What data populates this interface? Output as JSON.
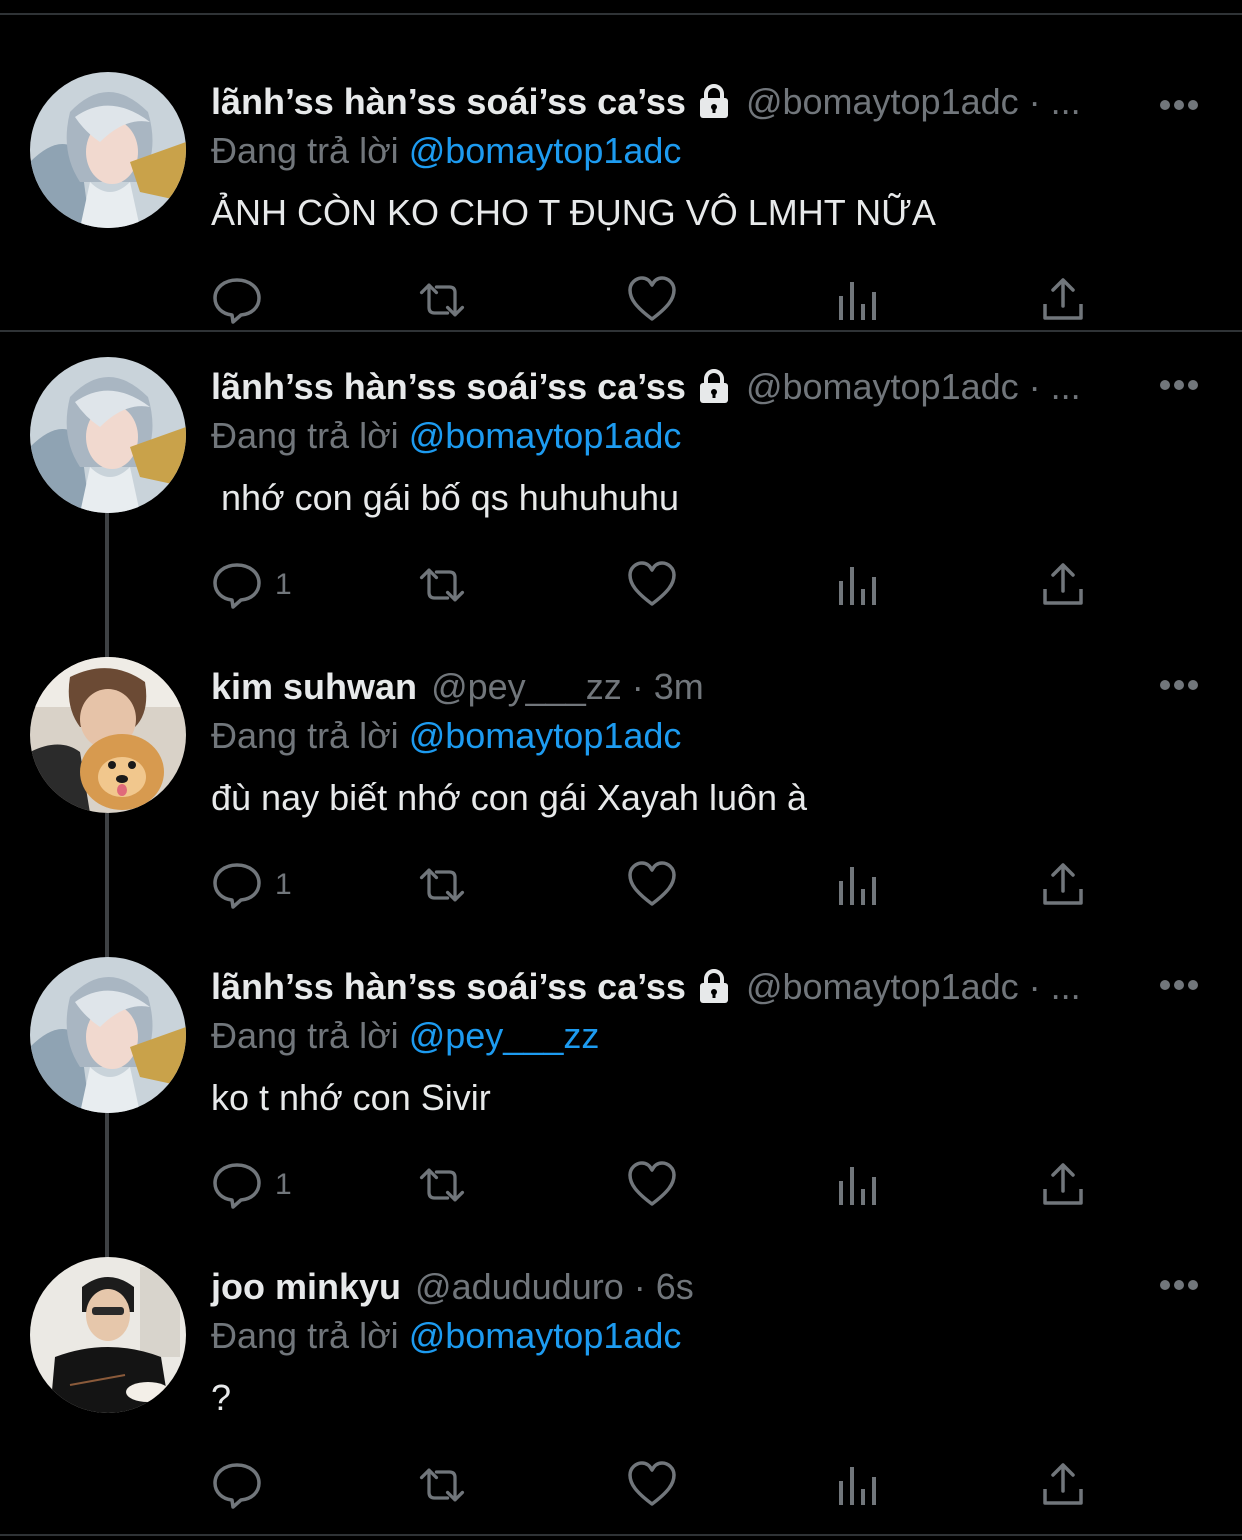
{
  "tweets": [
    {
      "name": "lãnh’ss hàn’ss soái’ss ca’ss",
      "locked": true,
      "handle": "@bomaytop1adc",
      "time": "· ...",
      "reply_prefix": "Đang trả lời",
      "reply_to": "@bomaytop1adc",
      "text": "ẢNH CÒN KO CHO T ĐỤNG VÔ LMHT NỮA",
      "reply_count": "",
      "avatar": "anime-character-avatar"
    },
    {
      "name": "lãnh’ss hàn’ss soái’ss ca’ss",
      "locked": true,
      "handle": "@bomaytop1adc",
      "time": "· ...",
      "reply_prefix": "Đang trả lời",
      "reply_to": "@bomaytop1adc",
      "text": " nhớ con gái bố qs huhuhuhu",
      "reply_count": "1",
      "avatar": "anime-character-avatar"
    },
    {
      "name": "kim suhwan",
      "locked": false,
      "handle": "@pey___zz",
      "time": "· 3m",
      "reply_prefix": "Đang trả lời",
      "reply_to": "@bomaytop1adc",
      "text": "đù nay biết nhớ con gái Xayah luôn à",
      "reply_count": "1",
      "avatar": "person-with-dog-avatar"
    },
    {
      "name": "lãnh’ss hàn’ss soái’ss ca’ss",
      "locked": true,
      "handle": "@bomaytop1adc",
      "time": "· ...",
      "reply_prefix": "Đang trả lời",
      "reply_to": "@pey___zz",
      "text": "ko t nhớ con Sivir",
      "reply_count": "1",
      "avatar": "anime-character-avatar"
    },
    {
      "name": "joo minkyu",
      "locked": false,
      "handle": "@adududuro",
      "time": "· 6s",
      "reply_prefix": "Đang trả lời",
      "reply_to": "@bomaytop1adc",
      "text": "?",
      "reply_count": "",
      "avatar": "person-eating-avatar"
    }
  ],
  "colors": {
    "background": "#000000",
    "text": "#e7e9ea",
    "secondary": "#71767b",
    "link": "#1d9bf0",
    "divider": "#2f3336"
  }
}
